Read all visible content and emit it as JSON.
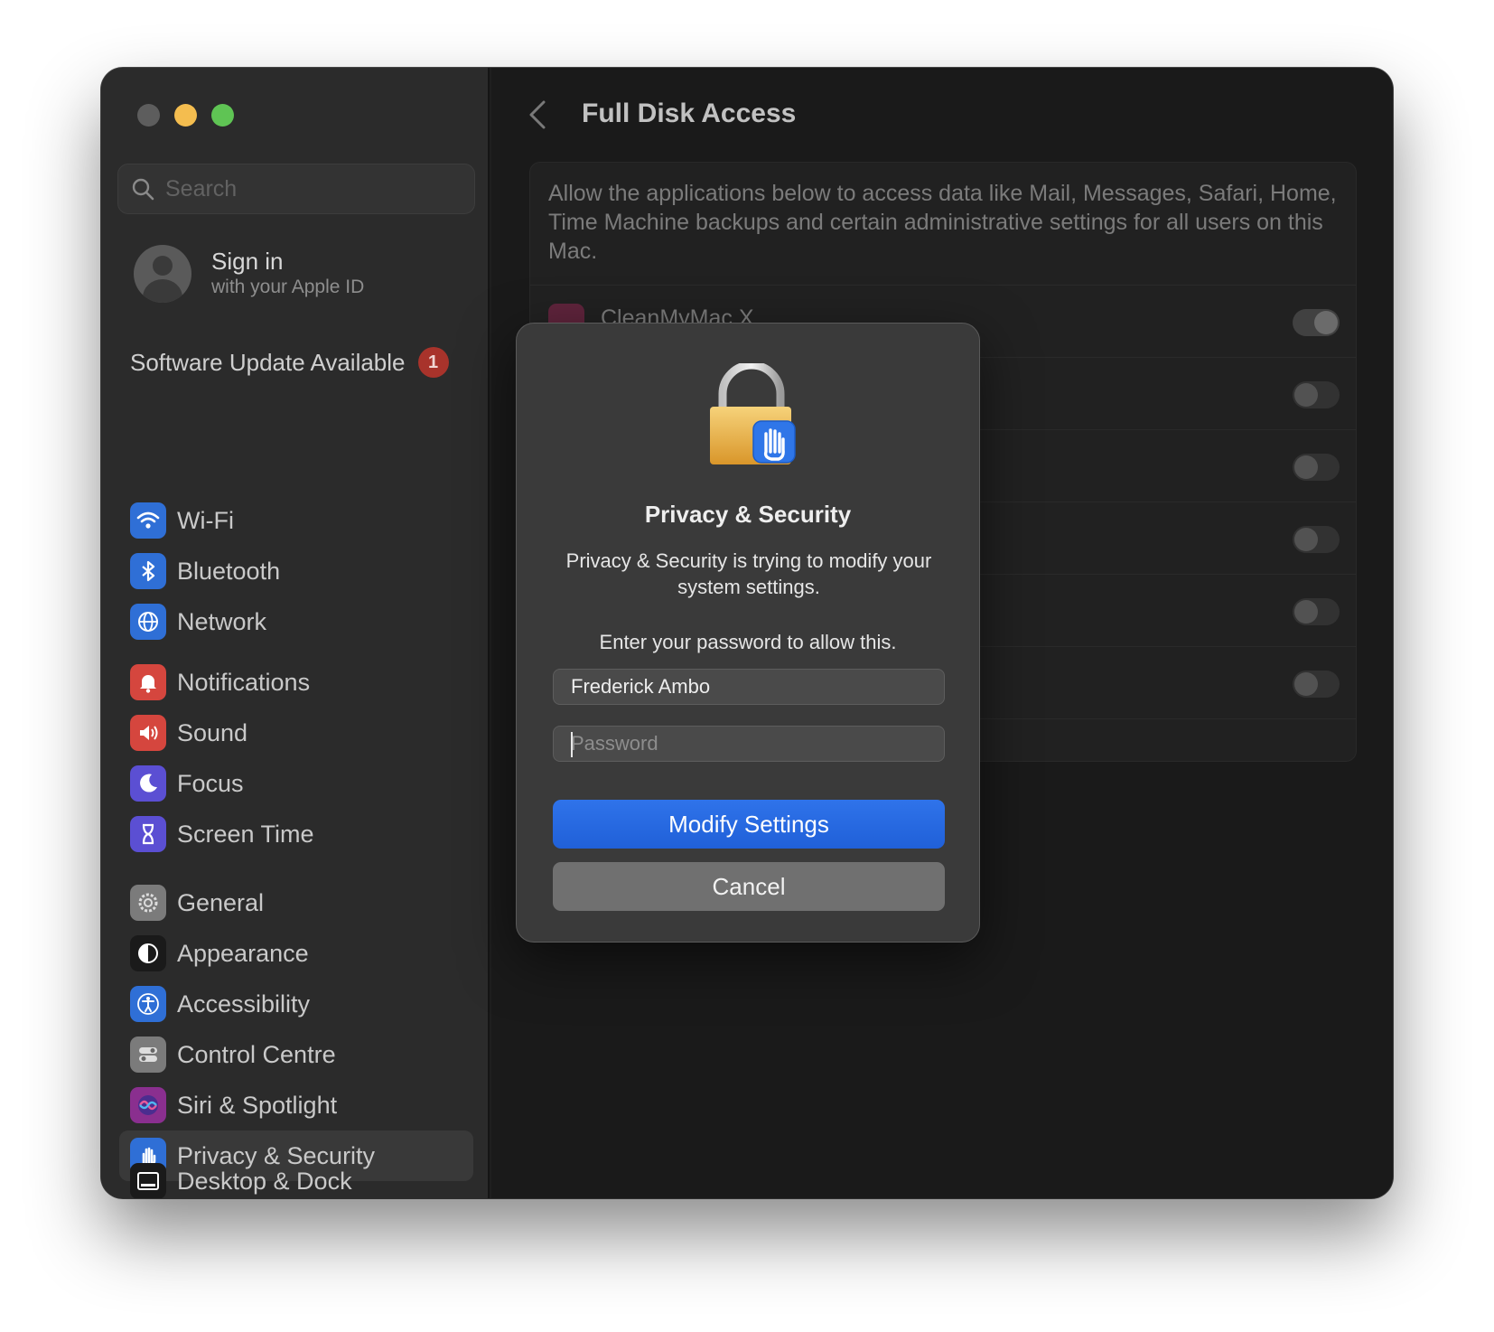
{
  "sidebar": {
    "search_placeholder": "Search",
    "account": {
      "title": "Sign in",
      "subtitle": "with your Apple ID"
    },
    "update": {
      "label": "Software Update Available",
      "badge": "1"
    },
    "groups": [
      [
        {
          "label": "Wi-Fi",
          "icon": "wifi-icon",
          "color": "#2f6fd6"
        },
        {
          "label": "Bluetooth",
          "icon": "bluetooth-icon",
          "color": "#2f6fd6"
        },
        {
          "label": "Network",
          "icon": "globe-icon",
          "color": "#2f6fd6"
        }
      ],
      [
        {
          "label": "Notifications",
          "icon": "bell-icon",
          "color": "#d5463e"
        },
        {
          "label": "Sound",
          "icon": "speaker-icon",
          "color": "#d5463e"
        },
        {
          "label": "Focus",
          "icon": "moon-icon",
          "color": "#5b4fd3"
        },
        {
          "label": "Screen Time",
          "icon": "hourglass-icon",
          "color": "#5b4fd3"
        }
      ],
      [
        {
          "label": "General",
          "icon": "gear-icon",
          "color": "#7b7b7b"
        },
        {
          "label": "Appearance",
          "icon": "appearance-icon",
          "color": "#1a1a1a"
        },
        {
          "label": "Accessibility",
          "icon": "accessibility-icon",
          "color": "#2f6fd6"
        },
        {
          "label": "Control Centre",
          "icon": "control-centre-icon",
          "color": "#7b7b7b"
        },
        {
          "label": "Siri & Spotlight",
          "icon": "siri-icon",
          "color": "#8a2f8f"
        },
        {
          "label": "Privacy & Security",
          "icon": "hand-icon",
          "color": "#2f6fd6",
          "selected": true
        }
      ],
      [
        {
          "label": "Desktop & Dock",
          "icon": "dock-icon",
          "color": "#1a1a1a"
        }
      ]
    ]
  },
  "content": {
    "title": "Full Disk Access",
    "description": "Allow the applications below to access data like Mail, Messages, Safari, Home, Time Machine backups and certain administrative settings for all users on this Mac.",
    "apps": [
      {
        "name": "CleanMyMac X",
        "enabled": true
      },
      {
        "name": "",
        "enabled": false
      },
      {
        "name": "",
        "enabled": false
      },
      {
        "name": "",
        "enabled": false
      },
      {
        "name": "",
        "enabled": false
      },
      {
        "name": "",
        "enabled": false
      }
    ]
  },
  "dialog": {
    "title": "Privacy & Security",
    "message": "Privacy & Security is trying to modify your system settings.",
    "prompt": "Enter your password to allow this.",
    "username": "Frederick Ambo",
    "password_placeholder": "Password",
    "primary_label": "Modify Settings",
    "cancel_label": "Cancel"
  }
}
